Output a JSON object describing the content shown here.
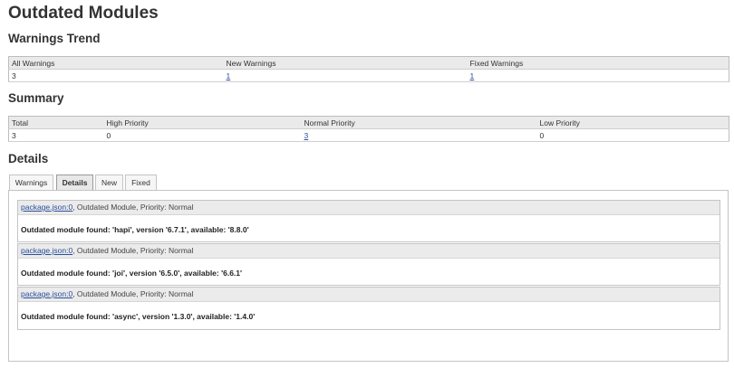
{
  "page_title": "Outdated Modules",
  "trend": {
    "heading": "Warnings Trend",
    "columns": [
      "All Warnings",
      "New Warnings",
      "Fixed Warnings"
    ],
    "values": [
      "3",
      "1",
      "1"
    ]
  },
  "summary": {
    "heading": "Summary",
    "columns": [
      "Total",
      "High Priority",
      "Normal Priority",
      "Low Priority"
    ],
    "values": [
      "3",
      "0",
      "3",
      "0"
    ]
  },
  "details": {
    "heading": "Details",
    "tabs": [
      "Warnings",
      "Details",
      "New",
      "Fixed"
    ],
    "active_tab": "Details",
    "warnings": [
      {
        "link": "package.json:0",
        "meta": ", Outdated Module, Priority: Normal",
        "message": "Outdated module found: 'hapi', version '6.7.1', available: '8.8.0'"
      },
      {
        "link": "package.json:0",
        "meta": ", Outdated Module, Priority: Normal",
        "message": "Outdated module found: 'joi', version '6.5.0', available: '6.6.1'"
      },
      {
        "link": "package.json:0",
        "meta": ", Outdated Module, Priority: Normal",
        "message": "Outdated module found: 'async', version '1.3.0', available: '1.4.0'"
      }
    ]
  },
  "colors": {
    "link": "#2a4f9b",
    "header_bg": "#eaeaea",
    "border": "#c4c4c4"
  }
}
